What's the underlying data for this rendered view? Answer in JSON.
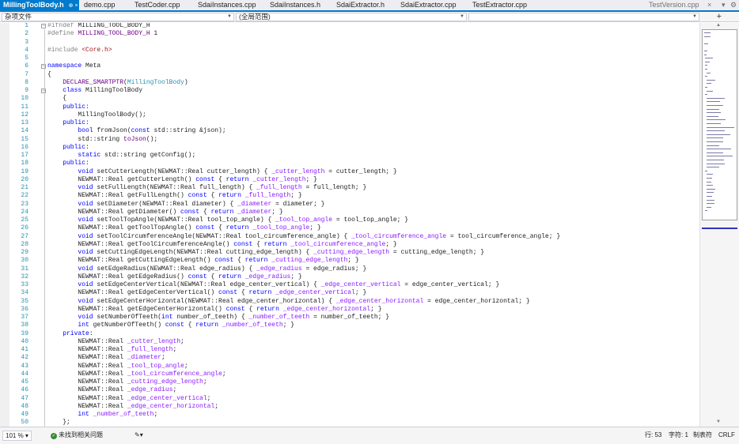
{
  "tabs": [
    {
      "label": "MillingToolBody.h",
      "active": true,
      "icons": "⊕ ×"
    },
    {
      "label": "demo.cpp"
    },
    {
      "label": "TestCoder.cpp"
    },
    {
      "label": "SdaiInstances.cpp"
    },
    {
      "label": "SdaiInstances.h"
    },
    {
      "label": "SdaiExtractor.h"
    },
    {
      "label": "SdaiExtractor.cpp"
    },
    {
      "label": "TestExtractor.cpp"
    }
  ],
  "tab_right": {
    "label": "TestVersion.cpp",
    "close": "×",
    "dropdown": "▾",
    "gear": "⚙"
  },
  "navbar": {
    "project": "杂项文件",
    "scope": "(全局范围)",
    "member": "",
    "split_icon": "+"
  },
  "code": {
    "lines": [
      {
        "n": "1",
        "text": "#ifndef MILLING_TOOL_BODY_H",
        "fold": "−"
      },
      {
        "n": "2",
        "text": "#define MILLING_TOOL_BODY_H 1"
      },
      {
        "n": "3",
        "text": ""
      },
      {
        "n": "4",
        "text": "#include <Core.h>"
      },
      {
        "n": "5",
        "text": ""
      },
      {
        "n": "6",
        "text": "namespace Meta",
        "fold": "−"
      },
      {
        "n": "7",
        "text": "{"
      },
      {
        "n": "8",
        "text": "    DECLARE_SMARTPTR(MillingToolBody)"
      },
      {
        "n": "9",
        "text": "    class MillingToolBody",
        "fold": "−"
      },
      {
        "n": "10",
        "text": "    {"
      },
      {
        "n": "11",
        "text": "    public:"
      },
      {
        "n": "12",
        "text": "        MillingToolBody();"
      },
      {
        "n": "13",
        "text": "    public:"
      },
      {
        "n": "14",
        "text": "        bool fromJson(const std::string &json);"
      },
      {
        "n": "15",
        "text": "        std::string toJson();"
      },
      {
        "n": "16",
        "text": "    public:"
      },
      {
        "n": "17",
        "text": "        static std::string getConfig();"
      },
      {
        "n": "18",
        "text": "    public:"
      },
      {
        "n": "19",
        "text": "        void setCutterLength(NEWMAT::Real cutter_length) { _cutter_length = cutter_length; }"
      },
      {
        "n": "20",
        "text": "        NEWMAT::Real getCutterLength() const { return _cutter_length; }"
      },
      {
        "n": "21",
        "text": "        void setFullLength(NEWMAT::Real full_length) { _full_length = full_length; }"
      },
      {
        "n": "22",
        "text": "        NEWMAT::Real getFullLength() const { return _full_length; }"
      },
      {
        "n": "23",
        "text": "        void setDiameter(NEWMAT::Real diameter) { _diameter = diameter; }"
      },
      {
        "n": "24",
        "text": "        NEWMAT::Real getDiameter() const { return _diameter; }"
      },
      {
        "n": "25",
        "text": "        void setToolTopAngle(NEWMAT::Real tool_top_angle) { _tool_top_angle = tool_top_angle; }"
      },
      {
        "n": "26",
        "text": "        NEWMAT::Real getToolTopAngle() const { return _tool_top_angle; }"
      },
      {
        "n": "27",
        "text": "        void setToolCircumferenceAngle(NEWMAT::Real tool_circumference_angle) { _tool_circumference_angle = tool_circumference_angle; }"
      },
      {
        "n": "28",
        "text": "        NEWMAT::Real getToolCircumferenceAngle() const { return _tool_circumference_angle; }"
      },
      {
        "n": "29",
        "text": "        void setCuttingEdgeLength(NEWMAT::Real cutting_edge_length) { _cutting_edge_length = cutting_edge_length; }"
      },
      {
        "n": "30",
        "text": "        NEWMAT::Real getCuttingEdgeLength() const { return _cutting_edge_length; }"
      },
      {
        "n": "31",
        "text": "        void setEdgeRadius(NEWMAT::Real edge_radius) { _edge_radius = edge_radius; }"
      },
      {
        "n": "32",
        "text": "        NEWMAT::Real getEdgeRadius() const { return _edge_radius; }"
      },
      {
        "n": "33",
        "text": "        void setEdgeCenterVertical(NEWMAT::Real edge_center_vertical) { _edge_center_vertical = edge_center_vertical; }"
      },
      {
        "n": "34",
        "text": "        NEWMAT::Real getEdgeCenterVertical() const { return _edge_center_vertical; }"
      },
      {
        "n": "35",
        "text": "        void setEdgeCenterHorizontal(NEWMAT::Real edge_center_horizontal) { _edge_center_horizontal = edge_center_horizontal; }"
      },
      {
        "n": "36",
        "text": "        NEWMAT::Real getEdgeCenterHorizontal() const { return _edge_center_horizontal; }"
      },
      {
        "n": "37",
        "text": "        void setNumberOfTeeth(int number_of_teeth) { _number_of_teeth = number_of_teeth; }"
      },
      {
        "n": "38",
        "text": "        int getNumberOfTeeth() const { return _number_of_teeth; }"
      },
      {
        "n": "39",
        "text": "    private:"
      },
      {
        "n": "40",
        "text": "        NEWMAT::Real _cutter_length;"
      },
      {
        "n": "41",
        "text": "        NEWMAT::Real _full_length;"
      },
      {
        "n": "42",
        "text": "        NEWMAT::Real _diameter;"
      },
      {
        "n": "43",
        "text": "        NEWMAT::Real _tool_top_angle;"
      },
      {
        "n": "44",
        "text": "        NEWMAT::Real _tool_circumference_angle;"
      },
      {
        "n": "45",
        "text": "        NEWMAT::Real _cutting_edge_length;"
      },
      {
        "n": "46",
        "text": "        NEWMAT::Real _edge_radius;"
      },
      {
        "n": "47",
        "text": "        NEWMAT::Real _edge_center_vertical;"
      },
      {
        "n": "48",
        "text": "        NEWMAT::Real _edge_center_horizontal;"
      },
      {
        "n": "49",
        "text": "        int _number_of_teeth;"
      },
      {
        "n": "50",
        "text": "    };"
      }
    ]
  },
  "colors": {
    "keyword": "#0000ff",
    "preprocessor": "#808080",
    "include": "#a31515",
    "macro": "#6f008a",
    "type": "#2b91af",
    "member": "#8a1bff",
    "accent": "#007acc"
  },
  "status": {
    "zoom": "101 %",
    "issues": "未找到相关问题",
    "line": "行: 53",
    "char": "字符: 1",
    "tabs": "制表符",
    "eol": "CRLF"
  }
}
